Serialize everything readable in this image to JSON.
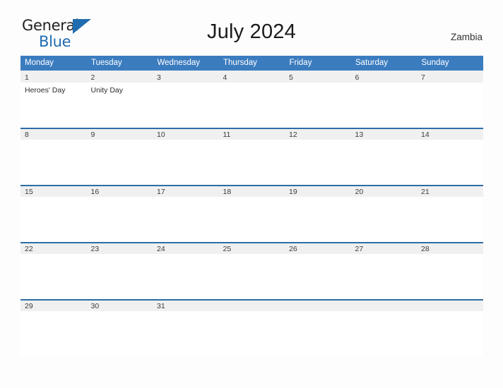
{
  "logo": {
    "word_top": "General",
    "word_bottom": "Blue",
    "triangle_color": "#1f6cb0",
    "text_color": "#231f20"
  },
  "header": {
    "title": "July 2024",
    "country": "Zambia"
  },
  "theme": {
    "header_blue": "#3b7cbf",
    "rule_blue": "#2e6da4",
    "date_band_gray": "#f0f0f0",
    "page_background": "#fdfdfd"
  },
  "calendar": {
    "weekday_headers": [
      "Monday",
      "Tuesday",
      "Wednesday",
      "Thursday",
      "Friday",
      "Saturday",
      "Sunday"
    ],
    "weeks": [
      [
        {
          "date": "1",
          "event": "Heroes' Day",
          "filled": true
        },
        {
          "date": "2",
          "event": "Unity Day",
          "filled": true
        },
        {
          "date": "3",
          "event": "",
          "filled": true
        },
        {
          "date": "4",
          "event": "",
          "filled": true
        },
        {
          "date": "5",
          "event": "",
          "filled": true
        },
        {
          "date": "6",
          "event": "",
          "filled": true
        },
        {
          "date": "7",
          "event": "",
          "filled": true
        }
      ],
      [
        {
          "date": "8",
          "event": "",
          "filled": true
        },
        {
          "date": "9",
          "event": "",
          "filled": true
        },
        {
          "date": "10",
          "event": "",
          "filled": true
        },
        {
          "date": "11",
          "event": "",
          "filled": true
        },
        {
          "date": "12",
          "event": "",
          "filled": true
        },
        {
          "date": "13",
          "event": "",
          "filled": true
        },
        {
          "date": "14",
          "event": "",
          "filled": true
        }
      ],
      [
        {
          "date": "15",
          "event": "",
          "filled": true
        },
        {
          "date": "16",
          "event": "",
          "filled": true
        },
        {
          "date": "17",
          "event": "",
          "filled": true
        },
        {
          "date": "18",
          "event": "",
          "filled": true
        },
        {
          "date": "19",
          "event": "",
          "filled": true
        },
        {
          "date": "20",
          "event": "",
          "filled": true
        },
        {
          "date": "21",
          "event": "",
          "filled": true
        }
      ],
      [
        {
          "date": "22",
          "event": "",
          "filled": true
        },
        {
          "date": "23",
          "event": "",
          "filled": true
        },
        {
          "date": "24",
          "event": "",
          "filled": true
        },
        {
          "date": "25",
          "event": "",
          "filled": true
        },
        {
          "date": "26",
          "event": "",
          "filled": true
        },
        {
          "date": "27",
          "event": "",
          "filled": true
        },
        {
          "date": "28",
          "event": "",
          "filled": true
        }
      ],
      [
        {
          "date": "29",
          "event": "",
          "filled": true
        },
        {
          "date": "30",
          "event": "",
          "filled": true
        },
        {
          "date": "31",
          "event": "",
          "filled": true
        },
        {
          "date": "",
          "event": "",
          "filled": true
        },
        {
          "date": "",
          "event": "",
          "filled": true
        },
        {
          "date": "",
          "event": "",
          "filled": true
        },
        {
          "date": "",
          "event": "",
          "filled": true
        }
      ]
    ]
  }
}
